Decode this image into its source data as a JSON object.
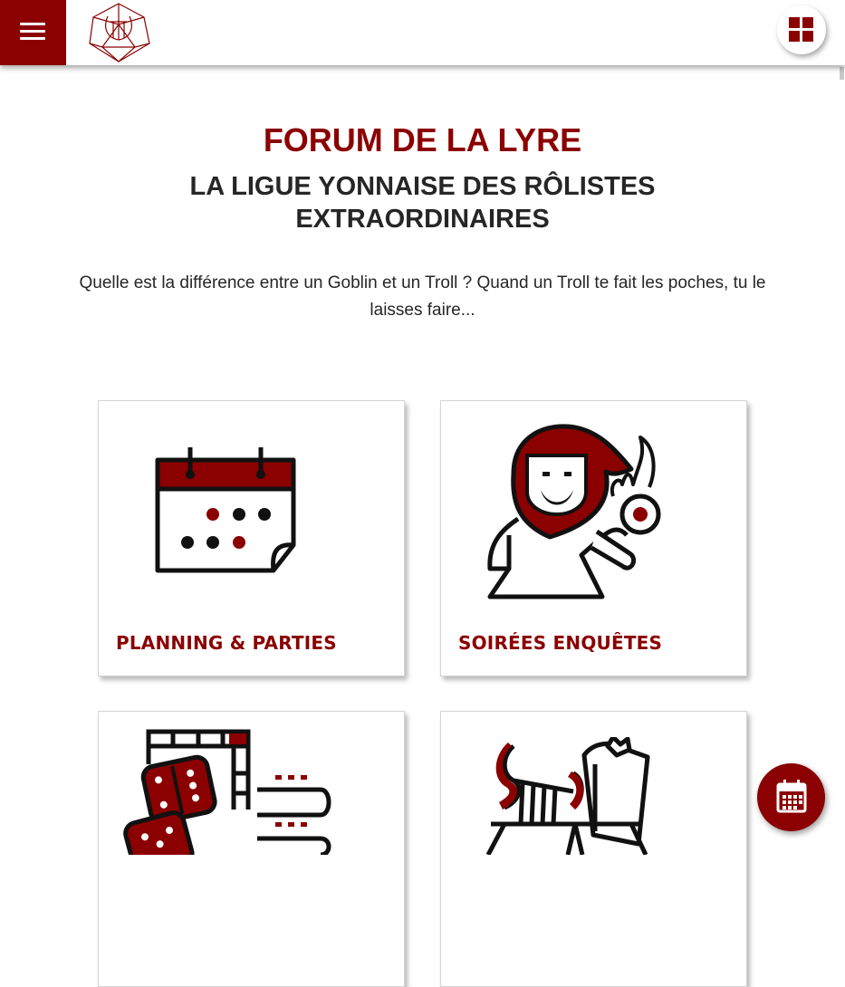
{
  "header": {
    "menu_icon": "hamburger-icon",
    "logo_icon": "lyre-dice-logo",
    "apps_icon": "grid-icon"
  },
  "hero": {
    "title": "FORUM DE LA LYRE",
    "subtitle": "LA LIGUE YONNAISE DES RÔLISTES EXTRAORDINAIRES",
    "tagline": "Quelle est la différence entre un Goblin et un Troll ? Quand un Troll te fait les poches, tu le laisses faire..."
  },
  "cards": [
    {
      "label": "PLANNING & PARTIES",
      "icon": "calendar-icon"
    },
    {
      "label": "SOIRÉES ENQUÊTES",
      "icon": "wizard-icon"
    },
    {
      "label": "",
      "icon": "board-game-dice-icon"
    },
    {
      "label": "",
      "icon": "lyre-book-icon"
    }
  ],
  "fab": {
    "icon": "calendar-icon"
  },
  "colors": {
    "brand": "#8b0000",
    "text": "#262626",
    "background": "#ffffff"
  }
}
